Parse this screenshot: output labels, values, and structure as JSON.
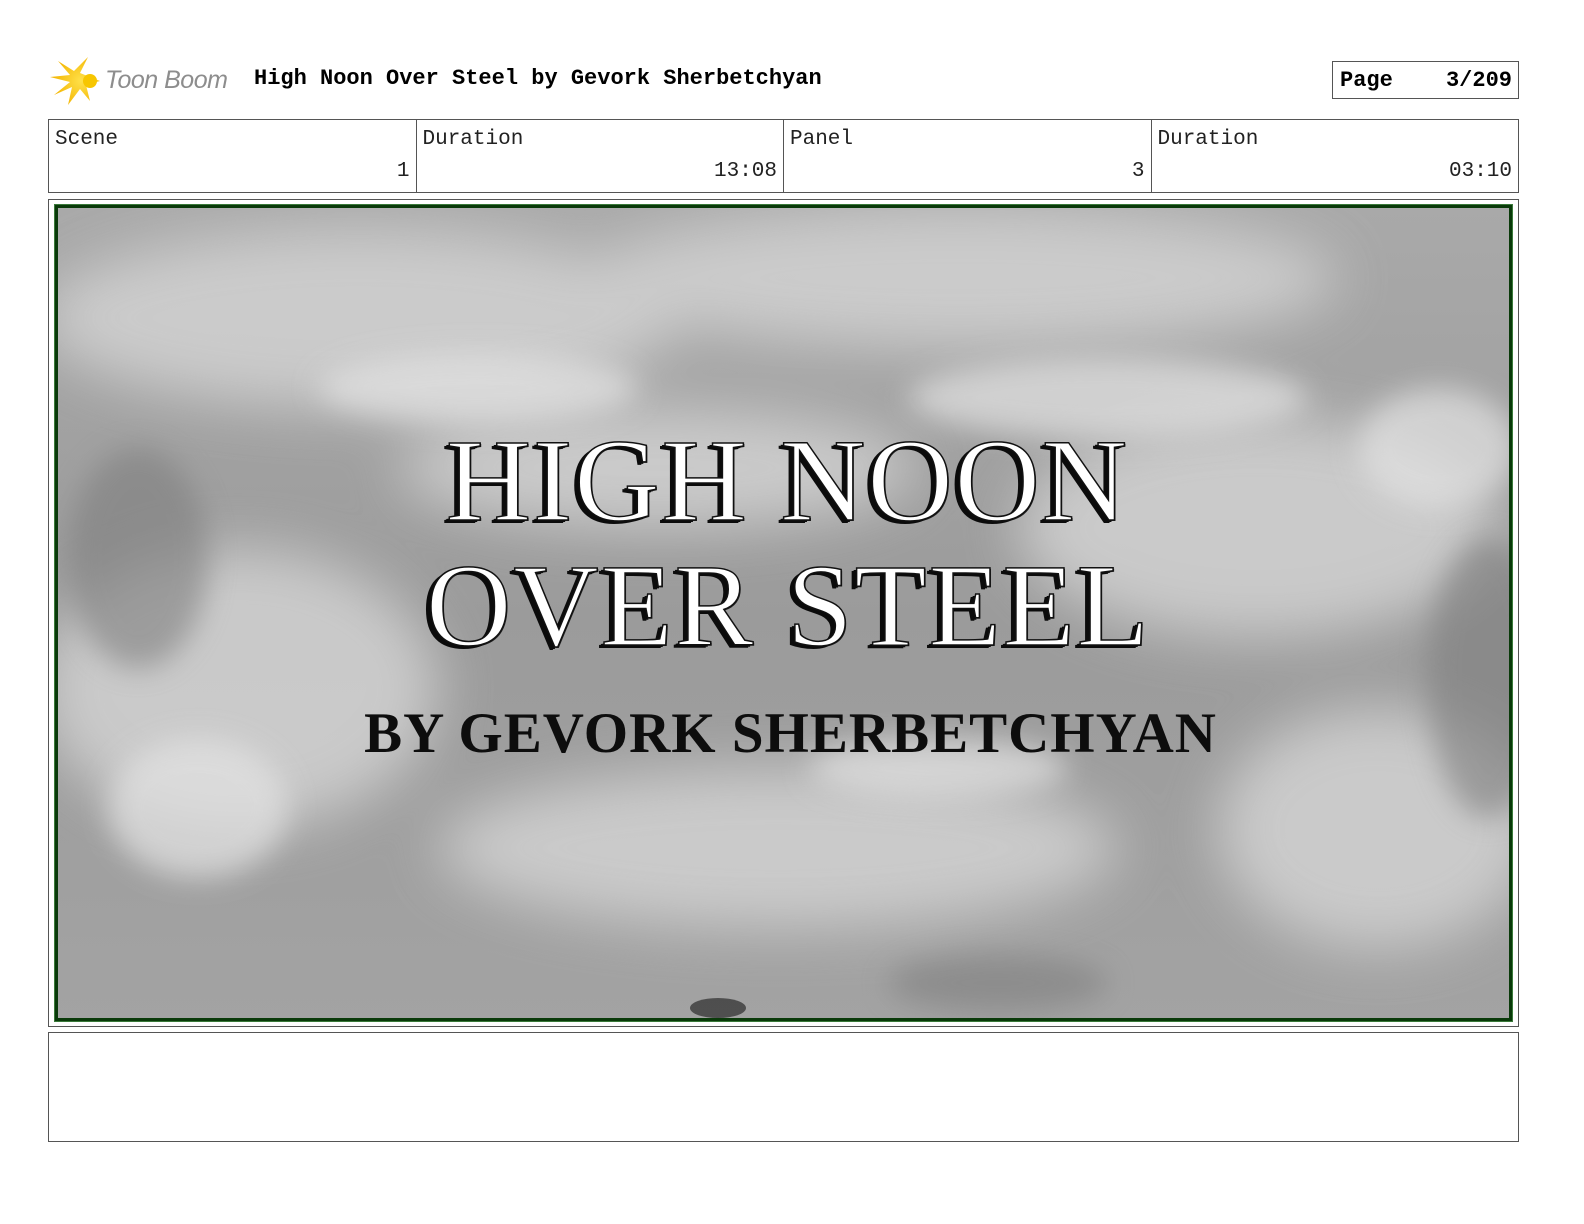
{
  "header": {
    "logo_text": "Toon Boom",
    "logo_icon": "starburst-icon",
    "title": "High Noon Over Steel by Gevork Sherbetchyan",
    "page_label": "Page",
    "page_value": "3/209"
  },
  "info": {
    "scene_label": "Scene",
    "scene_value": "1",
    "scene_duration_label": "Duration",
    "scene_duration_value": "13:08",
    "panel_label": "Panel",
    "panel_value": "3",
    "panel_duration_label": "Duration",
    "panel_duration_value": "03:10"
  },
  "panel": {
    "line1": "HIGH NOON",
    "line2": "OVER STEEL",
    "line3": "BY GEVORK SHERBETCHYAN",
    "frame_color": "#0a3a0a"
  },
  "notes": {
    "text": ""
  }
}
